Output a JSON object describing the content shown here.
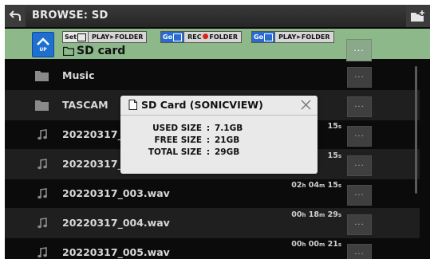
{
  "titlebar": {
    "title": "BROWSE: SD"
  },
  "header": {
    "set_key": "Set",
    "play_folder_pre": "PLAY",
    "play_folder_post": "FOLDER",
    "go_key": "Go",
    "rec_folder_pre": "REC",
    "rec_folder_post": "FOLDER",
    "go2_key": "Go",
    "play2_pre": "PLAY",
    "play2_post": "FOLDER",
    "up_label": "UP",
    "current_name": "SD card",
    "menu_label": "···"
  },
  "files": [
    {
      "type": "folder",
      "name": "Music",
      "duration": ""
    },
    {
      "type": "folder",
      "name": "TASCAM",
      "duration": ""
    },
    {
      "type": "audio",
      "name": "20220317_0",
      "duration_h": "",
      "duration_m": "",
      "duration_s": "15"
    },
    {
      "type": "audio",
      "name": "20220317_0",
      "duration_h": "",
      "duration_m": "",
      "duration_s": "15"
    },
    {
      "type": "audio",
      "name": "20220317_003.wav",
      "duration_h": "02",
      "duration_m": "04",
      "duration_s": "15"
    },
    {
      "type": "audio",
      "name": "20220317_004.wav",
      "duration_h": "00",
      "duration_m": "18",
      "duration_s": "29"
    },
    {
      "type": "audio",
      "name": "20220317_005.wav",
      "duration_h": "00",
      "duration_m": "00",
      "duration_s": "21"
    }
  ],
  "units": {
    "h": "h",
    "m": "m",
    "s": "s"
  },
  "row_menu_label": "···",
  "popup": {
    "title": "SD Card (SONICVIEW)",
    "rows": [
      {
        "label": "USED SIZE",
        "sep": ":",
        "value": "7.1GB"
      },
      {
        "label": "FREE SIZE",
        "sep": ":",
        "value": "21GB"
      },
      {
        "label": "TOTAL SIZE",
        "sep": ":",
        "value": "29GB"
      }
    ]
  },
  "colors": {
    "header_green": "#8db88a",
    "up_blue": "#1f6fd1",
    "go_blue": "#2a6bd0",
    "rec_red": "#dd1111"
  },
  "icons": [
    "back-arrow-icon",
    "new-folder-icon",
    "up-arrow-icon",
    "folder-icon",
    "music-note-icon",
    "sd-card-icon",
    "close-icon"
  ]
}
